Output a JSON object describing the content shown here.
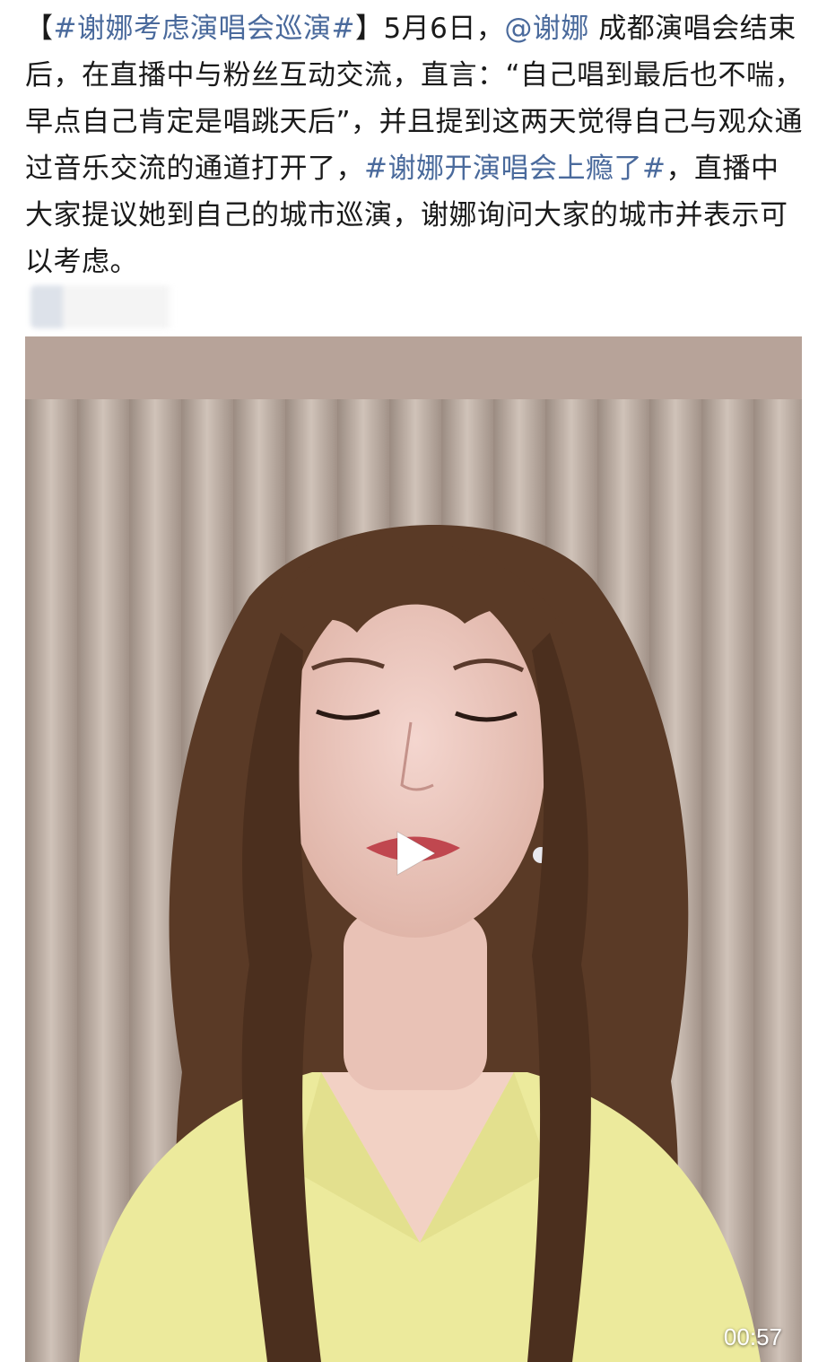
{
  "post": {
    "tag_open_bracket": "【",
    "headline_tag": "#谢娜考虑演唱会巡演#",
    "tag_close_bracket": "】",
    "text_1": "5月6日，",
    "mention": "@谢娜",
    "text_2": " 成都演唱会结束后，在直播中与粉丝互动交流，直言：“自己唱到最后也不喘，早点自己肯定是唱跳天后”，并且提到这两天觉得自己与观众通过音乐交流的通道打开了，",
    "inline_tag": "#谢娜开演唱会上瘾了#",
    "text_3": "，直播中大家提议她到自己的城市巡演，谢娜询问大家的城市并表示可以考虑。"
  },
  "video": {
    "duration": "00:57",
    "play_icon": "play-icon"
  },
  "colors": {
    "link": "#4a6a9c",
    "text": "#1a1a1a"
  }
}
